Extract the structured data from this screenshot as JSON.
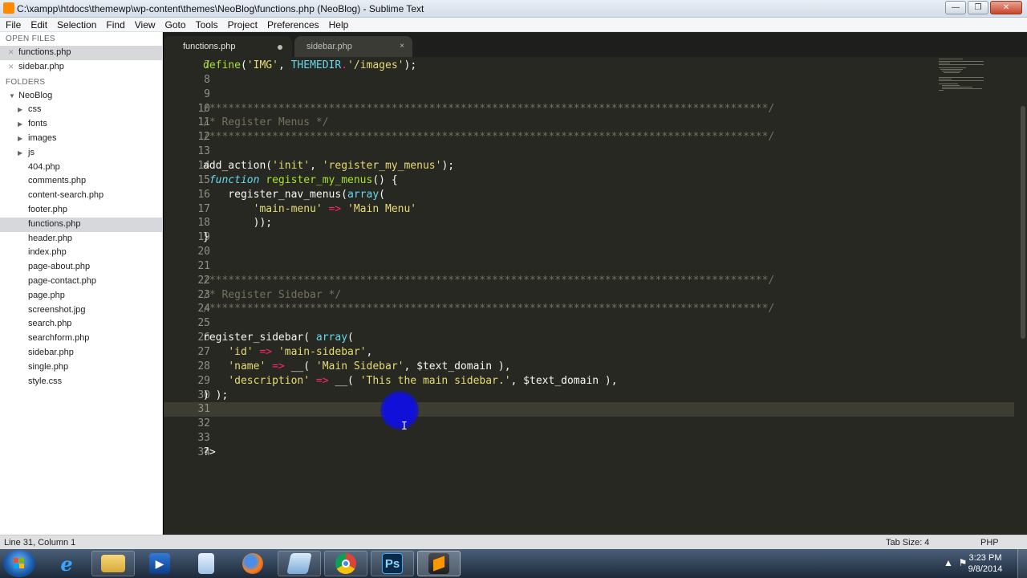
{
  "window": {
    "title": "C:\\xampp\\htdocs\\themewp\\wp-content\\themes\\NeoBlog\\functions.php (NeoBlog) - Sublime Text",
    "btn_minimize": "—",
    "btn_restore": "❐",
    "btn_close": "✕"
  },
  "menu": [
    "File",
    "Edit",
    "Selection",
    "Find",
    "View",
    "Goto",
    "Tools",
    "Project",
    "Preferences",
    "Help"
  ],
  "sidebar": {
    "open_files_header": "OPEN FILES",
    "open_files": [
      {
        "label": "functions.php",
        "selected": true
      },
      {
        "label": "sidebar.php",
        "selected": false
      }
    ],
    "folders_header": "FOLDERS",
    "root": "NeoBlog",
    "subfolders": [
      "css",
      "fonts",
      "images",
      "js"
    ],
    "files": [
      "404.php",
      "comments.php",
      "content-search.php",
      "footer.php",
      "functions.php",
      "header.php",
      "index.php",
      "page-about.php",
      "page-contact.php",
      "page.php",
      "screenshot.jpg",
      "search.php",
      "searchform.php",
      "sidebar.php",
      "single.php",
      "style.css"
    ],
    "selected_file": "functions.php"
  },
  "tabs": [
    {
      "label": "functions.php",
      "active": true,
      "modified": true
    },
    {
      "label": "sidebar.php",
      "active": false,
      "close": "×"
    }
  ],
  "code_lines": [
    {
      "n": "7",
      "tokens": [
        [
          "f",
          "define"
        ],
        [
          "v",
          "("
        ],
        [
          "s",
          "'IMG'"
        ],
        [
          "v",
          ", "
        ],
        [
          "t",
          "THEMEDIR"
        ],
        [
          "o",
          "."
        ],
        [
          "s",
          "'/images'"
        ],
        [
          "v",
          ");"
        ]
      ]
    },
    {
      "n": "8",
      "tokens": []
    },
    {
      "n": "9",
      "tokens": []
    },
    {
      "n": "10",
      "tokens": [
        [
          "c",
          "/*****************************************************************************************/"
        ]
      ]
    },
    {
      "n": "11",
      "tokens": [
        [
          "c",
          "/* Register Menus */"
        ]
      ]
    },
    {
      "n": "12",
      "tokens": [
        [
          "c",
          "/*****************************************************************************************/"
        ]
      ]
    },
    {
      "n": "13",
      "tokens": []
    },
    {
      "n": "14",
      "tokens": [
        [
          "v",
          "add_action("
        ],
        [
          "s",
          "'init'"
        ],
        [
          "v",
          ", "
        ],
        [
          "s",
          "'register_my_menus'"
        ],
        [
          "v",
          ");"
        ]
      ]
    },
    {
      "n": "15",
      "tokens": [
        [
          "v",
          " "
        ],
        [
          "k",
          "function"
        ],
        [
          "v",
          " "
        ],
        [
          "f",
          "register_my_menus"
        ],
        [
          "v",
          "() {"
        ]
      ]
    },
    {
      "n": "16",
      "tokens": [
        [
          "v",
          "    register_nav_menus("
        ],
        [
          "t",
          "array"
        ],
        [
          "v",
          "("
        ]
      ]
    },
    {
      "n": "17",
      "tokens": [
        [
          "v",
          "        "
        ],
        [
          "s",
          "'main-menu'"
        ],
        [
          "v",
          " "
        ],
        [
          "o",
          "=>"
        ],
        [
          "v",
          " "
        ],
        [
          "s",
          "'Main Menu'"
        ]
      ]
    },
    {
      "n": "18",
      "tokens": [
        [
          "v",
          "        ));"
        ]
      ]
    },
    {
      "n": "19",
      "tokens": [
        [
          "v",
          "}"
        ]
      ]
    },
    {
      "n": "20",
      "tokens": []
    },
    {
      "n": "21",
      "tokens": []
    },
    {
      "n": "22",
      "tokens": [
        [
          "c",
          "/*****************************************************************************************/"
        ]
      ]
    },
    {
      "n": "23",
      "tokens": [
        [
          "c",
          "/* Register Sidebar */"
        ]
      ]
    },
    {
      "n": "24",
      "tokens": [
        [
          "c",
          "/*****************************************************************************************/"
        ]
      ]
    },
    {
      "n": "25",
      "tokens": []
    },
    {
      "n": "26",
      "tokens": [
        [
          "v",
          "register_sidebar( "
        ],
        [
          "t",
          "array"
        ],
        [
          "v",
          "("
        ]
      ]
    },
    {
      "n": "27",
      "tokens": [
        [
          "v",
          "    "
        ],
        [
          "s",
          "'id'"
        ],
        [
          "v",
          " "
        ],
        [
          "o",
          "=>"
        ],
        [
          "v",
          " "
        ],
        [
          "s",
          "'main-sidebar'"
        ],
        [
          "v",
          ","
        ]
      ]
    },
    {
      "n": "28",
      "tokens": [
        [
          "v",
          "    "
        ],
        [
          "s",
          "'name'"
        ],
        [
          "v",
          " "
        ],
        [
          "o",
          "=>"
        ],
        [
          "v",
          " __( "
        ],
        [
          "s",
          "'Main Sidebar'"
        ],
        [
          "v",
          ", $text_domain ),"
        ]
      ]
    },
    {
      "n": "29",
      "tokens": [
        [
          "v",
          "    "
        ],
        [
          "s",
          "'description'"
        ],
        [
          "v",
          " "
        ],
        [
          "o",
          "=>"
        ],
        [
          "v",
          " __( "
        ],
        [
          "s",
          "'This the main sidebar.'"
        ],
        [
          "v",
          ", $text_domain ),"
        ]
      ]
    },
    {
      "n": "30",
      "tokens": [
        [
          "v",
          ") );"
        ]
      ]
    },
    {
      "n": "31",
      "tokens": [],
      "current": true
    },
    {
      "n": "32",
      "tokens": []
    },
    {
      "n": "33",
      "tokens": []
    },
    {
      "n": "34",
      "tokens": [
        [
          "v",
          "?>"
        ]
      ]
    }
  ],
  "status": {
    "position": "Line 31, Column 1",
    "tab_size": "Tab Size: 4",
    "syntax": "PHP"
  },
  "taskbar": {
    "apps": [
      "start",
      "internet-explorer",
      "file-explorer",
      "media-player",
      "notepad",
      "firefox",
      "file-manager",
      "chrome",
      "photoshop",
      "sublime-text"
    ],
    "ps_label": "Ps",
    "clock_time": "3:23 PM",
    "clock_date": "9/8/2014"
  },
  "colors": {
    "editor_bg": "#272822",
    "comment": "#75715e",
    "string": "#e6db74",
    "function": "#a6e22e",
    "keyword": "#66d9ef",
    "operator": "#f92672"
  }
}
